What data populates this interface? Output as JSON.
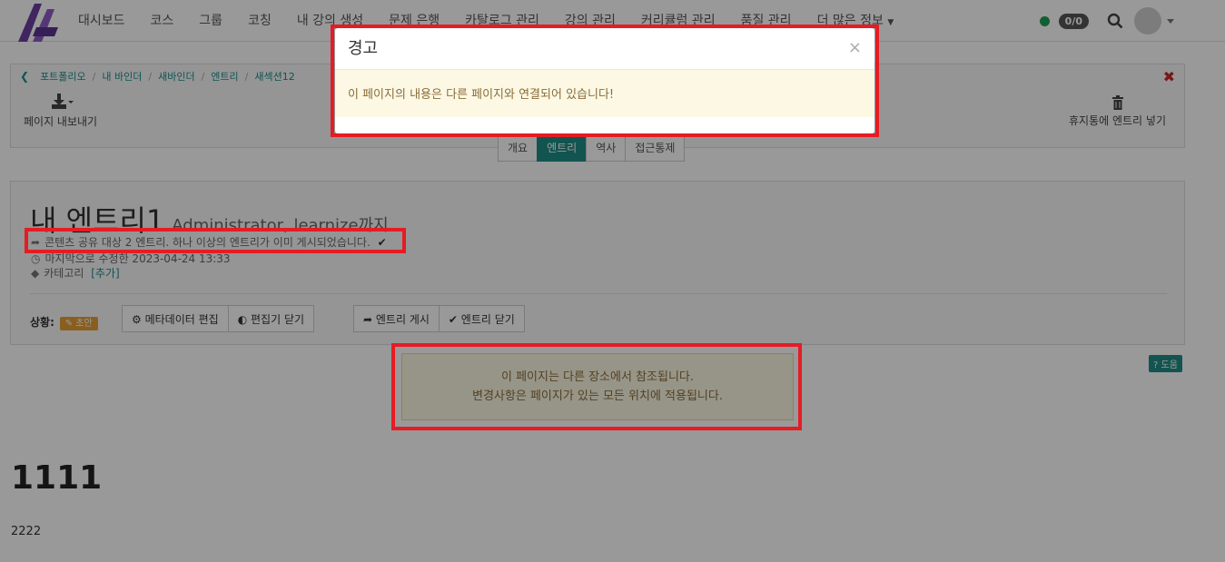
{
  "nav": {
    "items": [
      "대시보드",
      "코스",
      "그룹",
      "코칭",
      "내 강의 생성",
      "문제 은행",
      "카탈로그 관리",
      "강의 관리",
      "커리큘럼 관리",
      "품질 관리",
      "더 많은 정보"
    ],
    "counter": "0/0"
  },
  "breadcrumb": [
    "포트폴리오",
    "내 바인더",
    "새바인더",
    "엔트리",
    "새섹션12"
  ],
  "toolbar": {
    "export_label": "페이지 내보내기",
    "trash_label": "휴지통에 엔트리 넣기"
  },
  "tabs": [
    "개요",
    "엔트리",
    "역사",
    "접근통제"
  ],
  "entry": {
    "title": "내 엔트리1",
    "subtitle": "Administrator, learnize까지",
    "share_notice": "콘텐츠 공유 대상 2 엔트리. 하나 이상의 엔트리가 이미 게시되었습니다.",
    "modified": "마지막으로 수정한 2023-04-24 13:33",
    "category_label": "카테고리",
    "category_add": "[추가]",
    "status_label": "상황:",
    "status_badge": "초안",
    "btn_edit_meta": "메타데이터 편집",
    "btn_close_editor": "편집기 닫기",
    "btn_publish": "엔트리 게시",
    "btn_close_entry": "엔트리 닫기"
  },
  "info": {
    "line1": "이 페이지는 다른 장소에서 참조됩니다.",
    "line2": "변경사항은 페이지가 있는 모든 위치에 적용됩니다."
  },
  "help_label": "도움",
  "content": {
    "heading": "1111",
    "paragraph": "2222"
  },
  "modal": {
    "title": "경고",
    "close": "×",
    "message": "이 페이지의 내용은 다른 페이지와 연결되어 있습니다!"
  },
  "colors": {
    "accent": "#1f8d86",
    "highlight": "#e51c23",
    "warning_bg": "#fcf8e3",
    "warning_text": "#8a6d3b"
  }
}
